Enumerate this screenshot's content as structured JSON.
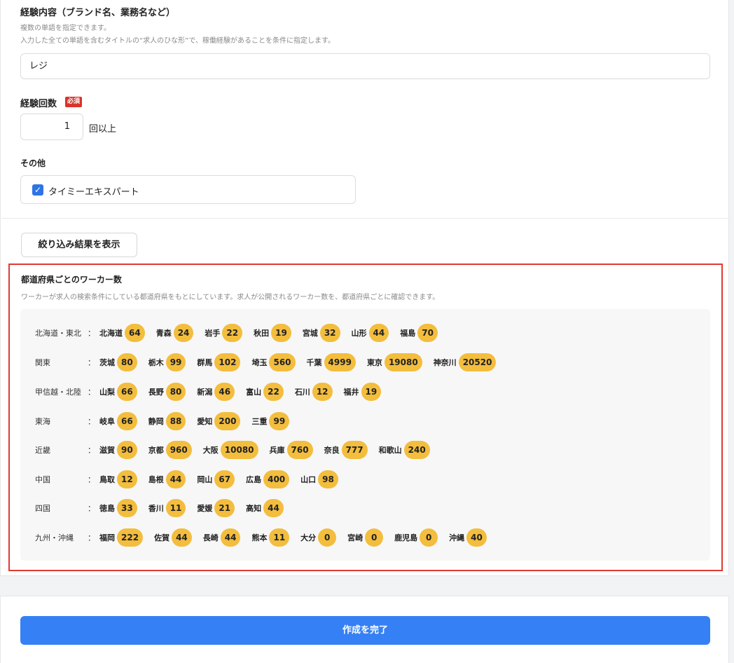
{
  "experience": {
    "title": "経験内容（ブランド名、業務名など）",
    "hint1": "複数の単語を指定できます。",
    "hint2": "入力した全ての単語を含むタイトルの“求人のひな形”で、稼働経験があることを条件に指定します。",
    "value": "レジ"
  },
  "count": {
    "title": "経験回数",
    "required_badge": "必須",
    "value": "1",
    "suffix": "回以上"
  },
  "other": {
    "title": "その他",
    "checkbox_label": "タイミーエキスパート",
    "checked": true
  },
  "filter_button": "絞り込み結果を表示",
  "workers": {
    "title": "都道府県ごとのワーカー数",
    "description": "ワーカーが求人の検索条件にしている都道府県をもとにしています。求人が公開されるワーカー数を、都道府県ごとに確認できます。",
    "colon": "：",
    "regions": [
      {
        "name": "北海道・東北",
        "prefectures": [
          [
            "北海道",
            "64"
          ],
          [
            "青森",
            "24"
          ],
          [
            "岩手",
            "22"
          ],
          [
            "秋田",
            "19"
          ],
          [
            "宮城",
            "32"
          ],
          [
            "山形",
            "44"
          ],
          [
            "福島",
            "70"
          ]
        ]
      },
      {
        "name": "関東",
        "prefectures": [
          [
            "茨城",
            "80"
          ],
          [
            "栃木",
            "99"
          ],
          [
            "群馬",
            "102"
          ],
          [
            "埼玉",
            "560"
          ],
          [
            "千葉",
            "4999"
          ],
          [
            "東京",
            "19080"
          ],
          [
            "神奈川",
            "20520"
          ]
        ]
      },
      {
        "name": "甲信越・北陸",
        "prefectures": [
          [
            "山梨",
            "66"
          ],
          [
            "長野",
            "80"
          ],
          [
            "新潟",
            "46"
          ],
          [
            "富山",
            "22"
          ],
          [
            "石川",
            "12"
          ],
          [
            "福井",
            "19"
          ]
        ]
      },
      {
        "name": "東海",
        "prefectures": [
          [
            "岐阜",
            "66"
          ],
          [
            "静岡",
            "88"
          ],
          [
            "愛知",
            "200"
          ],
          [
            "三重",
            "99"
          ]
        ]
      },
      {
        "name": "近畿",
        "prefectures": [
          [
            "滋賀",
            "90"
          ],
          [
            "京都",
            "960"
          ],
          [
            "大阪",
            "10080"
          ],
          [
            "兵庫",
            "760"
          ],
          [
            "奈良",
            "777"
          ],
          [
            "和歌山",
            "240"
          ]
        ]
      },
      {
        "name": "中国",
        "prefectures": [
          [
            "鳥取",
            "12"
          ],
          [
            "島根",
            "44"
          ],
          [
            "岡山",
            "67"
          ],
          [
            "広島",
            "400"
          ],
          [
            "山口",
            "98"
          ]
        ]
      },
      {
        "name": "四国",
        "prefectures": [
          [
            "徳島",
            "33"
          ],
          [
            "香川",
            "11"
          ],
          [
            "愛媛",
            "21"
          ],
          [
            "高知",
            "44"
          ]
        ]
      },
      {
        "name": "九州・沖縄",
        "prefectures": [
          [
            "福岡",
            "222"
          ],
          [
            "佐賀",
            "44"
          ],
          [
            "長崎",
            "44"
          ],
          [
            "熊本",
            "11"
          ],
          [
            "大分",
            "0"
          ],
          [
            "宮崎",
            "0"
          ],
          [
            "鹿児島",
            "0"
          ],
          [
            "沖縄",
            "40"
          ]
        ]
      }
    ]
  },
  "submit_button": "作成を完了",
  "colors": {
    "badge": "#f3bd3d",
    "primary": "#3580f5",
    "required": "#d9342b",
    "highlight_frame": "#e03a32"
  }
}
